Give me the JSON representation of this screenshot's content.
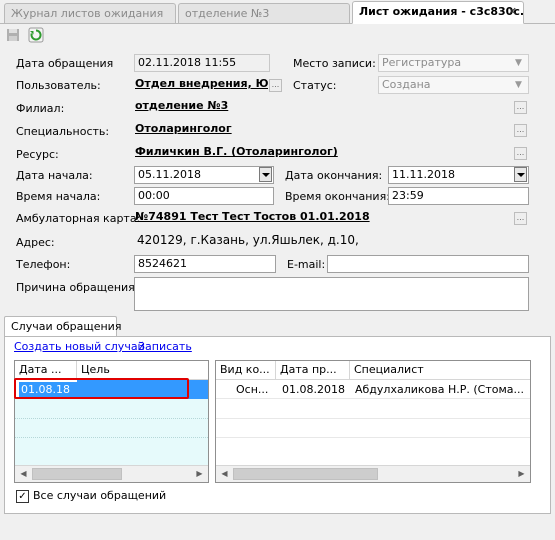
{
  "tabs": [
    {
      "label": "Журнал листов ожидания",
      "active": false
    },
    {
      "label": "отделение №3",
      "active": false
    },
    {
      "label": "Лист ожидания - c3c830c...",
      "active": true
    }
  ],
  "toolbar": {
    "save_icon": "floppy-disk-icon",
    "refresh_icon": "refresh-icon"
  },
  "form": {
    "date_label": "Дата обращения",
    "date_value": "02.11.2018 11:55",
    "place_label": "Место записи:",
    "place_value": "Регистратура",
    "user_label": "Пользователь:",
    "user_value": "Отдел внедрения, Юл",
    "status_label": "Статус:",
    "status_value": "Создана",
    "branch_label": "Филиал:",
    "branch_value": "отделение №3",
    "specialty_label": "Специальность:",
    "specialty_value": "Отоларинголог",
    "resource_label": "Ресурс:",
    "resource_value": "Филичкин В.Г. (Отоларинголог)",
    "start_date_label": "Дата начала:",
    "start_date_value": "05.11.2018",
    "end_date_label": "Дата окончания:",
    "end_date_value": "11.11.2018",
    "start_time_label": "Время начала:",
    "start_time_value": "00:00",
    "end_time_label": "Время окончания:",
    "end_time_value": "23:59",
    "card_label": "Амбулаторная карта:",
    "card_value": "№74891 Тест Тест Тостов 01.01.2018",
    "address_label": "Адрес:",
    "address_value": "420129, г.Казань, ул.Яшьлек, д.10,",
    "phone_label": "Телефон:",
    "phone_value": "8524621",
    "email_label": "E-mail:",
    "email_value": "",
    "reason_label": "Причина обращения:",
    "reason_value": ""
  },
  "cases": {
    "tab_label": "Случаи обращения",
    "create_link": "Создать новый случай",
    "record_link": "Записать",
    "left_grid": {
      "columns": [
        "Дата ...",
        "Цель"
      ],
      "rows": [
        [
          "01.08.18",
          ""
        ]
      ]
    },
    "right_grid": {
      "columns": [
        "Вид ко...",
        "Дата пр...",
        "Специалист"
      ],
      "rows": [
        [
          "Осн...",
          "01.08.2018",
          "Абдулхаликова Н.Р. (Стома..."
        ]
      ]
    },
    "all_cases_label": "Все случаи обращений",
    "all_cases_checked": true
  },
  "colors": {
    "selection": "#3399ff",
    "highlight_box": "#e00000",
    "row_tint": "#e6fafb"
  }
}
